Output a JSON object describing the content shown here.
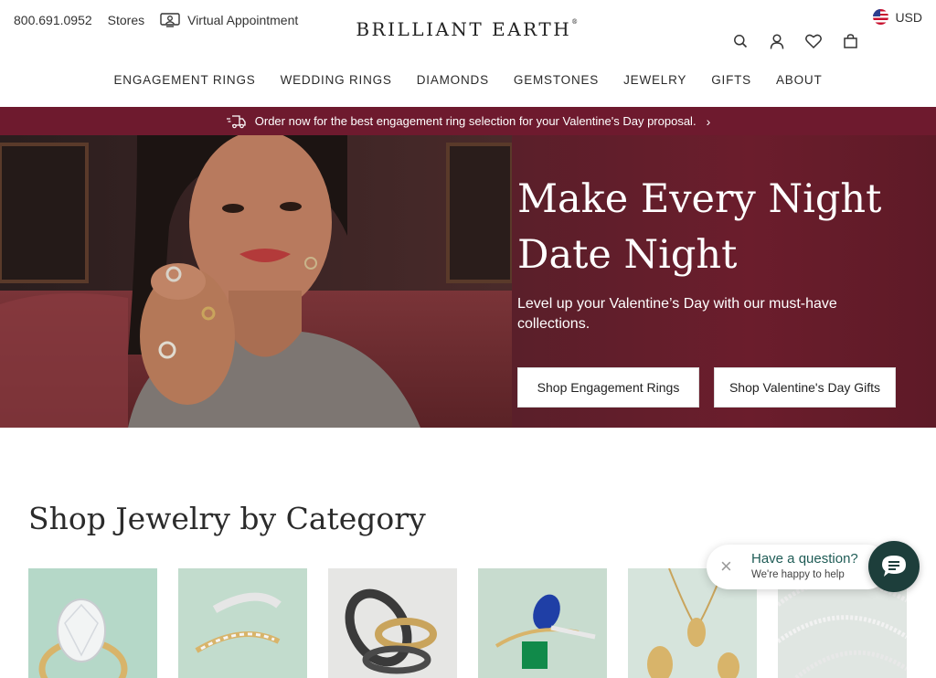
{
  "header": {
    "phone": "800.691.0952",
    "stores": "Stores",
    "virtual_appointment": "Virtual Appointment",
    "logo": "BRILLIANT EARTH",
    "logo_mark": "®",
    "currency": "USD",
    "icons": [
      "search-icon",
      "account-icon",
      "heart-icon",
      "bag-icon"
    ]
  },
  "nav": {
    "items": [
      "ENGAGEMENT RINGS",
      "WEDDING RINGS",
      "DIAMONDS",
      "GEMSTONES",
      "JEWELRY",
      "GIFTS",
      "ABOUT"
    ]
  },
  "promo": {
    "text": "Order now for the best engagement ring selection for your Valentine's Day proposal.",
    "bg": "#6e1a2e"
  },
  "hero": {
    "title_line1": "Make Every Night",
    "title_line2": "Date Night",
    "subtitle": "Level up your Valentine’s Day with our must-have collections.",
    "button1": "Shop Engagement Rings",
    "button2": "Shop Valentine's Day Gifts"
  },
  "category": {
    "title": "Shop Jewelry by Category",
    "tiles": [
      "engagement-rings",
      "wedding-rings",
      "mens-rings",
      "gemstone-rings",
      "necklaces",
      "bracelets"
    ]
  },
  "chat": {
    "question": "Have a question?",
    "help": "We're happy to help",
    "accent": "#1d3e3b"
  }
}
